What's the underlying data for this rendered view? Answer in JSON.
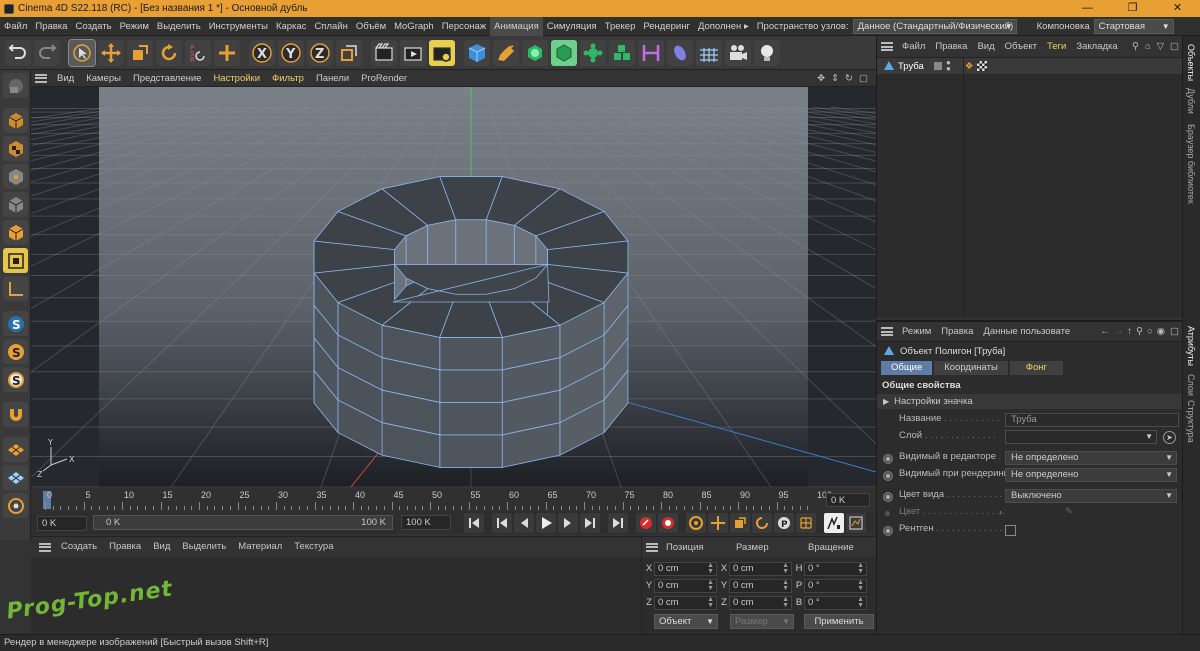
{
  "window": {
    "title": "Cinema 4D S22.118 (RC) - [Без названия 1 *] - Основной дубль"
  },
  "menubar": {
    "items": [
      "Файл",
      "Правка",
      "Создать",
      "Режим",
      "Выделить",
      "Инструменты",
      "Каркас",
      "Сплайн",
      "Объём",
      "MoGraph",
      "Персонаж",
      "Анимация",
      "Симуляция",
      "Трекер",
      "Рендеринг",
      "Дополнен ▸"
    ],
    "active_index": 11,
    "node_space_label": "Пространство узлов:",
    "node_space_value": "Данное (Стандартный/Физический)",
    "layout_label": "Компоновка",
    "layout_value": "Стартовая"
  },
  "toolbar": {
    "icons": [
      "undo-icon",
      "redo-icon",
      "live-selection-icon",
      "move-icon",
      "scale-icon",
      "rotate-icon",
      "psr-icon",
      "add-tool-icon",
      "axis-x-icon",
      "axis-y-icon",
      "axis-z-icon",
      "coordinate-system-icon",
      "render-view-icon",
      "render-picture-viewer-icon",
      "render-settings-icon",
      "cube-icon",
      "pen-icon",
      "subdivision-icon",
      "extrude-icon",
      "cloner-icon",
      "fracture-icon",
      "symmetry-icon",
      "deformer-icon",
      "floor-icon",
      "camera-icon",
      "light-icon"
    ]
  },
  "lefttools": {
    "icons": [
      "make-editable-icon",
      "model-mode-icon",
      "texture-mode-icon",
      "workplane-icon",
      "points-mode-icon",
      "polygons-mode-icon",
      "uv-mode-icon",
      "axis-mode-icon",
      "snap-icon",
      "snap-settings-icon",
      "quantize-icon",
      "magnet-icon",
      "floor-grid-icon",
      "sculpt-grid-icon",
      "soft-selection-icon"
    ]
  },
  "viewport": {
    "menu": [
      "Вид",
      "Камеры",
      "Представление",
      "Настройки",
      "Фильтр",
      "Панели",
      "ProRender"
    ],
    "highlight": [
      "Настройки",
      "Фильтр"
    ]
  },
  "timeline": {
    "ticks": [
      "0",
      "5",
      "10",
      "15",
      "20",
      "25",
      "30",
      "35",
      "40",
      "45",
      "50",
      "55",
      "60",
      "65",
      "70",
      "75",
      "80",
      "85",
      "90",
      "95",
      "100"
    ],
    "current_frame": "0 K"
  },
  "playbar": {
    "start": "0 K",
    "range_start": "0 K",
    "range_end": "100 K",
    "end": "100 K"
  },
  "material_manager": {
    "menu": [
      "Создать",
      "Правка",
      "Вид",
      "Выделить",
      "Материал",
      "Текстура"
    ]
  },
  "coordinates": {
    "headers": [
      "Позиция",
      "Размер",
      "Вращение"
    ],
    "rows": [
      {
        "axis": "X",
        "pos": "0 cm",
        "size_axis": "X",
        "size": "0 cm",
        "rot_axis": "H",
        "rot": "0 °"
      },
      {
        "axis": "Y",
        "pos": "0 cm",
        "size_axis": "Y",
        "size": "0 cm",
        "rot_axis": "P",
        "rot": "0 °"
      },
      {
        "axis": "Z",
        "pos": "0 cm",
        "size_axis": "Z",
        "size": "0 cm",
        "rot_axis": "B",
        "rot": "0 °"
      }
    ],
    "mode": "Объект",
    "size_mode": "Размер",
    "apply": "Применить"
  },
  "object_manager": {
    "menu": [
      "Файл",
      "Правка",
      "Вид",
      "Объект",
      "Теги",
      "Закладка"
    ],
    "highlight": "Теги",
    "objects": [
      {
        "name": "Труба"
      }
    ]
  },
  "attribute_manager": {
    "menu": [
      "Режим",
      "Правка",
      "Данные пользовате"
    ],
    "object_title": "Объект Полигон [Труба]",
    "tabs": [
      "Общие",
      "Координаты",
      "Фонг"
    ],
    "active_tab": 0,
    "section": "Общие свойства",
    "subsection": "Настройки значка",
    "fields": {
      "name_label": "Название",
      "name_value": "Труба",
      "layer_label": "Слой",
      "vis_editor_label": "Видимый в редакторе",
      "vis_editor_value": "Не определено",
      "vis_render_label": "Видимый при рендеринге",
      "vis_render_value": "Не определено",
      "color_view_label": "Цвет вида",
      "color_view_value": "Выключено",
      "color_label": "Цвет",
      "xray_label": "Рентген"
    }
  },
  "right_tabs": {
    "top": [
      "Объекты",
      "Дубли",
      "Браузер библиотек"
    ],
    "bottom": [
      "Атрибуты",
      "Слои",
      "Структура"
    ]
  },
  "statusbar": {
    "text": "Рендер в менеджере изображений [Быстрый вызов Shift+R]"
  },
  "watermark": {
    "text": "Prog-Top.net"
  },
  "colors": {
    "title_bg": "#e8a035",
    "accent_yellow": "#e6c64a",
    "tab_active": "#5d7ca6",
    "wire": "#8ab4e8"
  }
}
